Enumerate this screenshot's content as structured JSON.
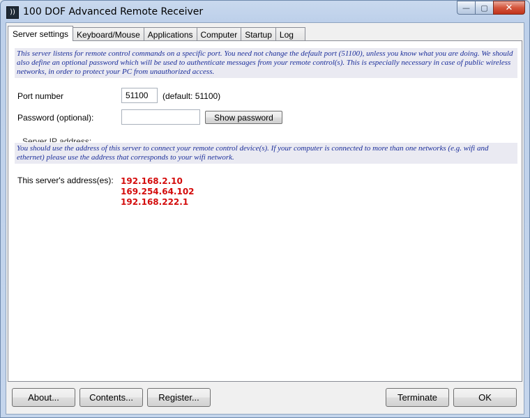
{
  "window": {
    "title": "100 DOF Advanced Remote Receiver",
    "icon": "speaker-signal-icon",
    "controls": {
      "minimize": "—",
      "maximize": "▢",
      "close": "✕"
    }
  },
  "tabs": [
    {
      "label": "Server settings",
      "active": true
    },
    {
      "label": "Keyboard/Mouse",
      "active": false
    },
    {
      "label": "Applications",
      "active": false
    },
    {
      "label": "Computer",
      "active": false
    },
    {
      "label": "Startup",
      "active": false
    },
    {
      "label": "Log",
      "active": false
    }
  ],
  "server": {
    "intro_note": "This server listens for remote control commands on a specific port. You need not change the default port (51100), unless you know what you are doing. We should also define an optional password which will be used to authenticate messages from your remote control(s). This is especially necessary in case of public wireless networks, in order to protect your PC from unauthorized access.",
    "port": {
      "label": "Port number",
      "value": "51100",
      "default_hint": "(default: 51100)"
    },
    "password": {
      "label": "Password (optional):",
      "value": "",
      "show_button": "Show password"
    },
    "ip_group_caption": "Server IP address:",
    "ip_note": "You should use the address of this server to connect your remote control device(s). If your computer is connected to more than one networks (e.g. wifi and ethernet) please use the address that corresponds to your wifi network.",
    "addresses_label": "This server's address(es):",
    "addresses": [
      "192.168.2.10",
      "169.254.64.102",
      "192.168.222.1"
    ]
  },
  "footer": {
    "about": "About...",
    "contents": "Contents...",
    "register": "Register...",
    "terminate": "Terminate",
    "ok": "OK"
  },
  "colors": {
    "note_text": "#1b2e9a",
    "address_text": "#d40c0c",
    "close_button": "#c8391f"
  }
}
